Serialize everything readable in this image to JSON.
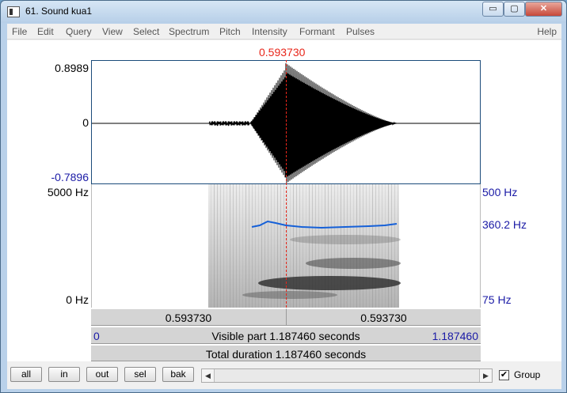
{
  "window": {
    "title": "61. Sound kua1",
    "min_glyph": "▭",
    "max_glyph": "▢",
    "close_glyph": "✕"
  },
  "menu": {
    "items": [
      "File",
      "Edit",
      "Query",
      "View",
      "Select",
      "Spectrum",
      "Pitch",
      "Intensity",
      "Formant",
      "Pulses"
    ],
    "help": "Help"
  },
  "editor": {
    "cursor_time": "0.593730",
    "wave_max": "0.8989",
    "wave_zero": "0",
    "wave_min": "-0.7896",
    "spec_top": "5000 Hz",
    "spec_bottom": "0 Hz",
    "pitch_top": "500 Hz",
    "pitch_value": "360.2 Hz",
    "pitch_bottom": "75 Hz",
    "bar_left_time": "0.593730",
    "bar_right_time": "0.593730",
    "visible_start": "0",
    "visible_text": "Visible part 1.187460 seconds",
    "visible_end": "1.187460",
    "total_text": "Total duration 1.187460 seconds"
  },
  "buttons": {
    "all": "all",
    "in": "in",
    "out": "out",
    "sel": "sel",
    "bak": "bak"
  },
  "scroll": {
    "left_arrow": "◀",
    "right_arrow": "▶"
  },
  "group": {
    "label": "Group",
    "checked": true,
    "check_glyph": "✔"
  },
  "colors": {
    "cursor": "#e8261a",
    "axis_blue": "#1a1aa6",
    "pitch_line": "#1560d8"
  }
}
